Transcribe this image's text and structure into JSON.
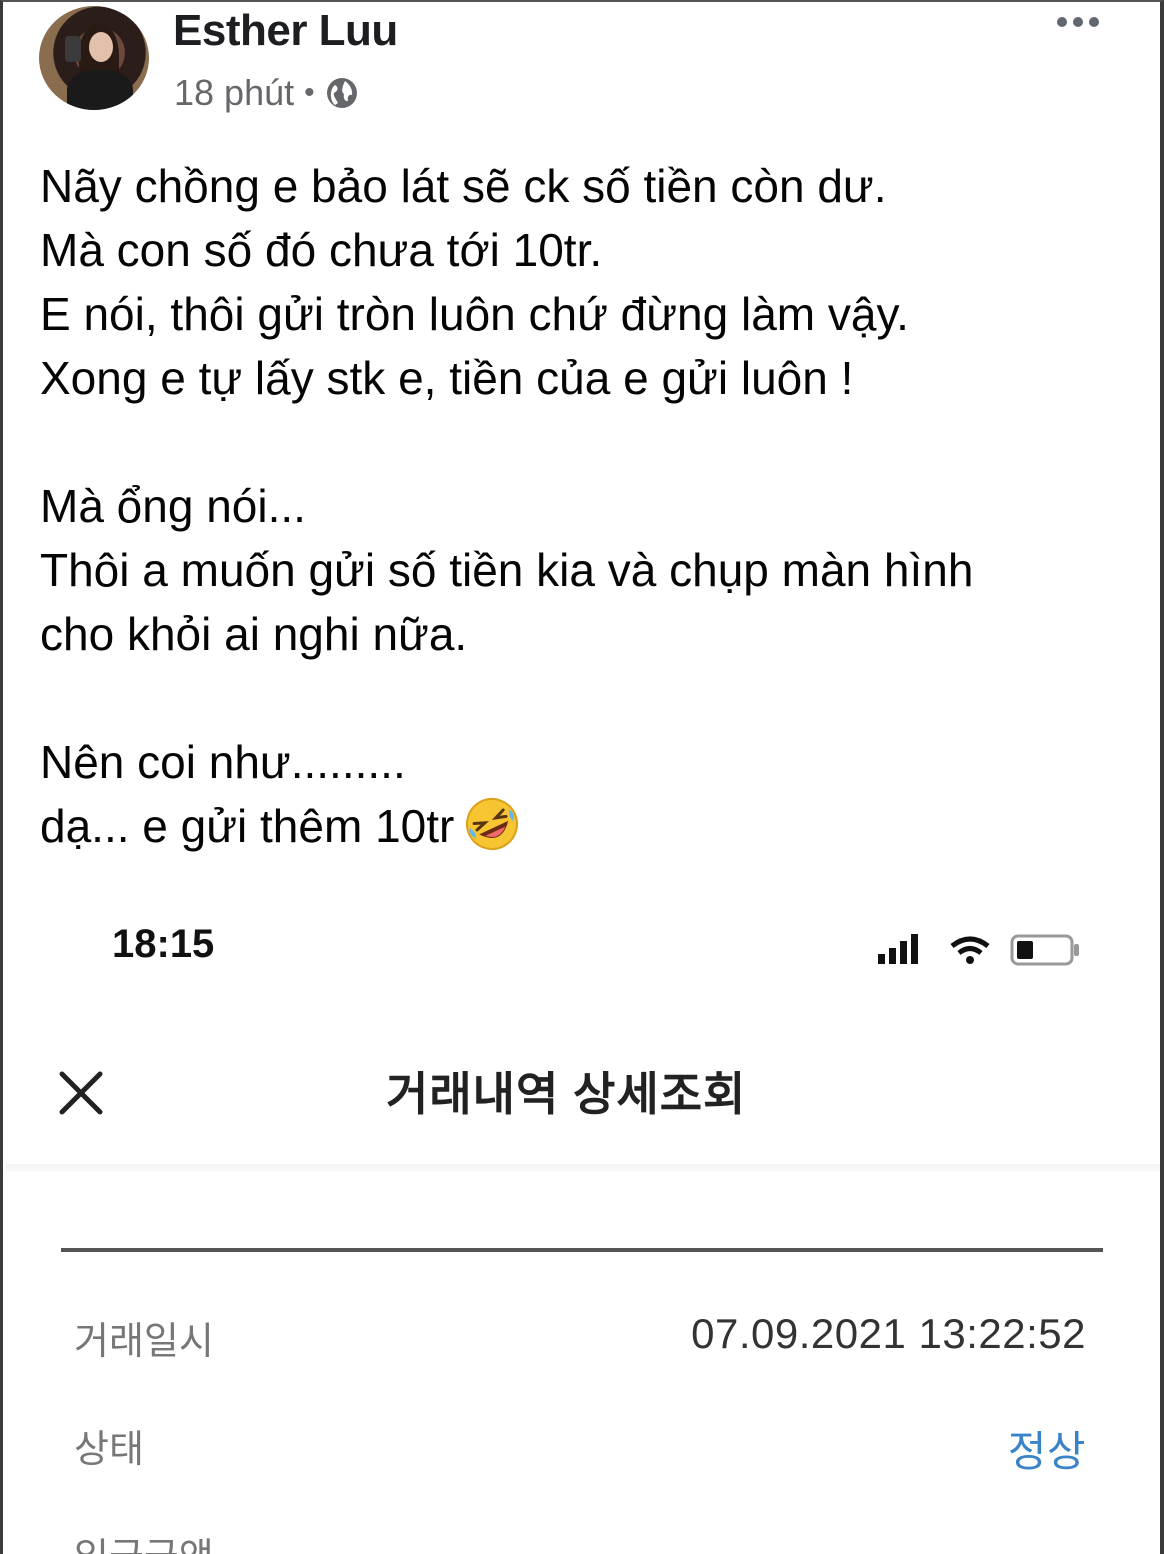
{
  "post": {
    "author": "Esther Luu",
    "time": "18 phút",
    "separator": "•",
    "lines": [
      "Nãy chồng e bảo lát sẽ ck số tiền còn dư.",
      "Mà con số đó chưa tới 10tr.",
      "E nói, thôi gửi tròn luôn chứ đừng làm vậy.",
      "Xong e tự lấy stk e, tiền của e gửi luôn !",
      "",
      "Mà ổng nói...",
      "Thôi a muốn gửi số tiền kia và chụp màn hình",
      "cho  khỏi ai nghi nữa.",
      "",
      "Nên coi như.........",
      "dạ... e gửi thêm 10tr"
    ]
  },
  "screenshot": {
    "status_time": "18:15",
    "title": "거래내역 상세조회",
    "rows": [
      {
        "label": "거래일시",
        "value": "07.09.2021  13:22:52"
      },
      {
        "label": "상태",
        "value": "정상"
      },
      {
        "label": "입금금액",
        "value": ""
      }
    ]
  },
  "colors": {
    "author": "#1c1e21",
    "meta": "#65676b",
    "status_value": "#3b83c7"
  }
}
